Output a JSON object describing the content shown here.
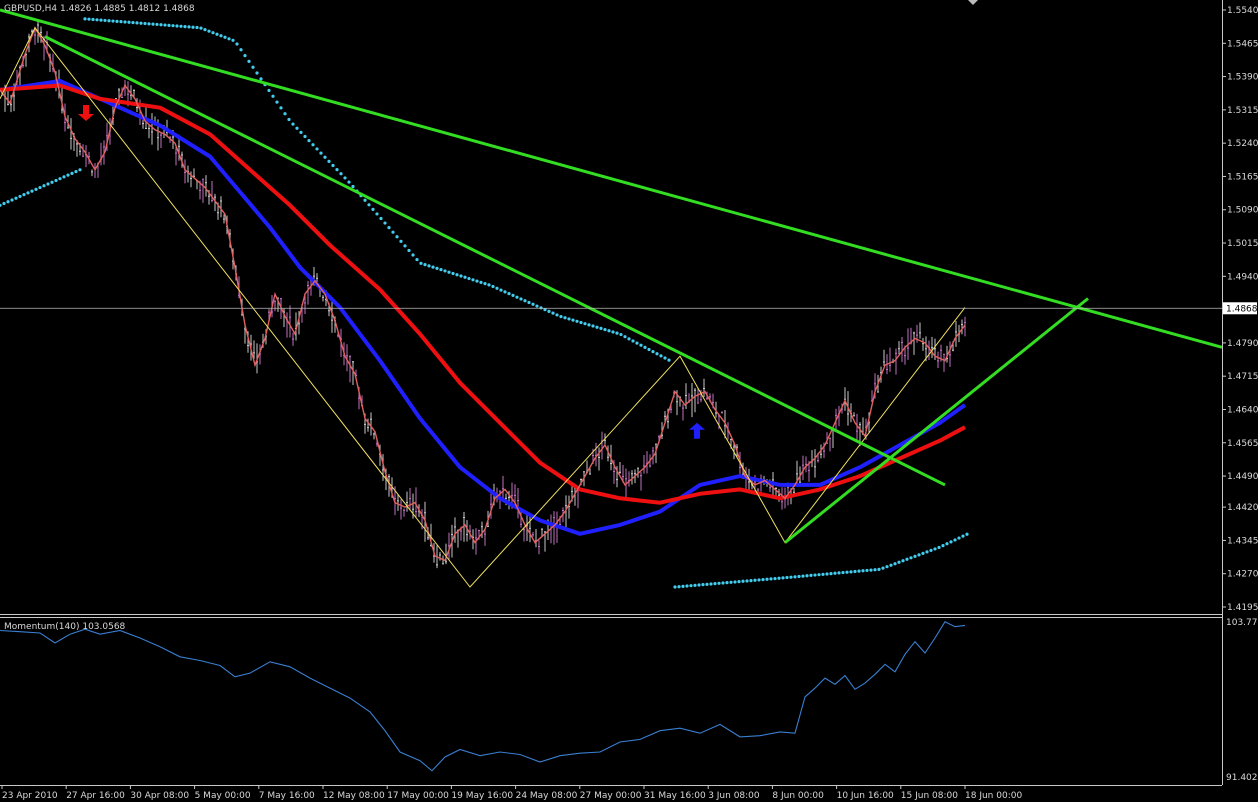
{
  "window": {
    "symbol_info": "GBPUSD,H4  1.4826 1.4885 1.4812 1.4868",
    "indicator_info": "Momentum(140) 103.0568"
  },
  "colors": {
    "background": "#000000",
    "candles": "#c8c8c8",
    "candle_accent": "#c070c0",
    "fast_ma": "#e06060",
    "ma_blue": "#2020ff",
    "ma_red": "#ee1010",
    "trendline": "#33dd22",
    "zigzag": "#f0e060",
    "sar": "#44ccee",
    "momentum": "#3a7fd0",
    "arrow_sell": "#ee1010",
    "arrow_buy": "#2020ff",
    "axis_text": "#d8d8d8"
  },
  "chart_data": [
    {
      "type": "candlestick",
      "symbol": "GBPUSD",
      "timeframe": "H4",
      "ohlc_header": {
        "open": 1.4826,
        "high": 1.4885,
        "low": 1.4812,
        "close": 1.4868
      },
      "current_price": "1.4868",
      "ylim": [
        1.4195,
        1.554
      ],
      "y_ticks": [
        "1.5540",
        "1.5465",
        "1.5390",
        "1.5315",
        "1.5240",
        "1.5165",
        "1.5090",
        "1.5015",
        "1.4940",
        "1.4790",
        "1.4715",
        "1.4640",
        "1.4565",
        "1.4490",
        "1.4420",
        "1.4345",
        "1.4270",
        "1.4195"
      ],
      "x_ticks": [
        "23 Apr 2010",
        "27 Apr 16:00",
        "30 Apr 08:00",
        "5 May 00:00",
        "7 May 16:00",
        "12 May 08:00",
        "17 May 00:00",
        "19 May 16:00",
        "24 May 08:00",
        "27 May 00:00",
        "31 May 16:00",
        "3 Jun 08:00",
        "8 Jun 00:00",
        "10 Jun 16:00",
        "15 Jun 08:00",
        "18 Jun 00:00"
      ],
      "close_path": [
        [
          0,
          1.536
        ],
        [
          10,
          1.533
        ],
        [
          25,
          1.544
        ],
        [
          35,
          1.55
        ],
        [
          45,
          1.546
        ],
        [
          55,
          1.54
        ],
        [
          65,
          1.53
        ],
        [
          75,
          1.525
        ],
        [
          85,
          1.522
        ],
        [
          95,
          1.518
        ],
        [
          105,
          1.522
        ],
        [
          115,
          1.532
        ],
        [
          125,
          1.537
        ],
        [
          135,
          1.534
        ],
        [
          145,
          1.529
        ],
        [
          155,
          1.527
        ],
        [
          165,
          1.526
        ],
        [
          175,
          1.524
        ],
        [
          185,
          1.518
        ],
        [
          195,
          1.516
        ],
        [
          205,
          1.514
        ],
        [
          215,
          1.511
        ],
        [
          225,
          1.508
        ],
        [
          235,
          1.496
        ],
        [
          245,
          1.483
        ],
        [
          255,
          1.474
        ],
        [
          265,
          1.48
        ],
        [
          275,
          1.49
        ],
        [
          285,
          1.485
        ],
        [
          295,
          1.481
        ],
        [
          305,
          1.49
        ],
        [
          315,
          1.493
        ],
        [
          325,
          1.49
        ],
        [
          335,
          1.484
        ],
        [
          345,
          1.476
        ],
        [
          355,
          1.472
        ],
        [
          365,
          1.462
        ],
        [
          375,
          1.459
        ],
        [
          385,
          1.45
        ],
        [
          395,
          1.443
        ],
        [
          405,
          1.442
        ],
        [
          415,
          1.443
        ],
        [
          425,
          1.439
        ],
        [
          435,
          1.431
        ],
        [
          445,
          1.43
        ],
        [
          455,
          1.436
        ],
        [
          465,
          1.438
        ],
        [
          475,
          1.434
        ],
        [
          485,
          1.437
        ],
        [
          495,
          1.444
        ],
        [
          505,
          1.446
        ],
        [
          515,
          1.443
        ],
        [
          525,
          1.438
        ],
        [
          535,
          1.434
        ],
        [
          545,
          1.436
        ],
        [
          555,
          1.438
        ],
        [
          565,
          1.441
        ],
        [
          575,
          1.445
        ],
        [
          585,
          1.449
        ],
        [
          595,
          1.453
        ],
        [
          605,
          1.456
        ],
        [
          615,
          1.451
        ],
        [
          625,
          1.447
        ],
        [
          635,
          1.449
        ],
        [
          645,
          1.451
        ],
        [
          655,
          1.454
        ],
        [
          665,
          1.461
        ],
        [
          675,
          1.468
        ],
        [
          685,
          1.465
        ],
        [
          695,
          1.467
        ],
        [
          705,
          1.468
        ],
        [
          715,
          1.464
        ],
        [
          725,
          1.461
        ],
        [
          735,
          1.456
        ],
        [
          745,
          1.449
        ],
        [
          755,
          1.447
        ],
        [
          765,
          1.448
        ],
        [
          775,
          1.446
        ],
        [
          785,
          1.444
        ],
        [
          795,
          1.447
        ],
        [
          805,
          1.451
        ],
        [
          815,
          1.453
        ],
        [
          825,
          1.456
        ],
        [
          835,
          1.461
        ],
        [
          845,
          1.466
        ],
        [
          855,
          1.461
        ],
        [
          865,
          1.458
        ],
        [
          875,
          1.468
        ],
        [
          885,
          1.474
        ],
        [
          895,
          1.475
        ],
        [
          905,
          1.478
        ],
        [
          915,
          1.48
        ],
        [
          925,
          1.479
        ],
        [
          935,
          1.476
        ],
        [
          945,
          1.475
        ],
        [
          955,
          1.48
        ],
        [
          965,
          1.483
        ]
      ],
      "series": [
        {
          "name": "",
          "color_key": "ma_blue",
          "points": [
            [
              0,
              1.536
            ],
            [
              60,
              1.538
            ],
            [
              100,
              1.534
            ],
            [
              160,
              1.528
            ],
            [
              210,
              1.521
            ],
            [
              240,
              1.513
            ],
            [
              270,
              1.505
            ],
            [
              300,
              1.496
            ],
            [
              340,
              1.487
            ],
            [
              380,
              1.475
            ],
            [
              420,
              1.462
            ],
            [
              460,
              1.451
            ],
            [
              500,
              1.444
            ],
            [
              540,
              1.439
            ],
            [
              580,
              1.436
            ],
            [
              620,
              1.438
            ],
            [
              660,
              1.441
            ],
            [
              700,
              1.447
            ],
            [
              740,
              1.449
            ],
            [
              780,
              1.447
            ],
            [
              820,
              1.447
            ],
            [
              860,
              1.451
            ],
            [
              900,
              1.456
            ],
            [
              940,
              1.461
            ],
            [
              965,
              1.465
            ]
          ]
        },
        {
          "name": "",
          "color_key": "ma_red",
          "points": [
            [
              0,
              1.536
            ],
            [
              60,
              1.537
            ],
            [
              100,
              1.534
            ],
            [
              160,
              1.532
            ],
            [
              210,
              1.526
            ],
            [
              250,
              1.518
            ],
            [
              290,
              1.51
            ],
            [
              330,
              1.501
            ],
            [
              380,
              1.491
            ],
            [
              420,
              1.481
            ],
            [
              460,
              1.47
            ],
            [
              500,
              1.461
            ],
            [
              540,
              1.452
            ],
            [
              580,
              1.446
            ],
            [
              620,
              1.444
            ],
            [
              660,
              1.443
            ],
            [
              700,
              1.445
            ],
            [
              740,
              1.446
            ],
            [
              780,
              1.444
            ],
            [
              820,
              1.446
            ],
            [
              860,
              1.449
            ],
            [
              900,
              1.453
            ],
            [
              940,
              1.457
            ],
            [
              965,
              1.46
            ]
          ]
        }
      ],
      "zigzag": [
        [
          0,
          1.534
        ],
        [
          35,
          1.55
        ],
        [
          470,
          1.424
        ],
        [
          680,
          1.476
        ],
        [
          785,
          1.434
        ],
        [
          965,
          1.487
        ]
      ],
      "parabolic_sar": [
        {
          "points": [
            [
              0,
              1.51
            ],
            [
              80,
              1.518
            ]
          ]
        },
        {
          "points": [
            [
              85,
              1.552
            ],
            [
              200,
              1.55
            ],
            [
              235,
              1.547
            ],
            [
              290,
              1.529
            ],
            [
              350,
              1.515
            ],
            [
              420,
              1.497
            ],
            [
              490,
              1.492
            ],
            [
              560,
              1.485
            ],
            [
              620,
              1.481
            ],
            [
              670,
              1.475
            ]
          ]
        },
        {
          "points": [
            [
              675,
              1.424
            ],
            [
              780,
              1.426
            ],
            [
              880,
              1.428
            ],
            [
              940,
              1.433
            ],
            [
              968,
              1.436
            ]
          ]
        }
      ],
      "trendlines": [
        {
          "from": [
            0,
            1.554
          ],
          "to": [
            1222,
            1.478
          ]
        },
        {
          "from": [
            45,
            1.548
          ],
          "to": [
            945,
            1.447
          ]
        },
        {
          "from": [
            785,
            1.434
          ],
          "to": [
            1088,
            1.489
          ]
        }
      ],
      "arrows": [
        {
          "direction": "sell",
          "x": 86,
          "price": 1.529
        },
        {
          "direction": "buy",
          "x": 697,
          "price": 1.461
        }
      ]
    },
    {
      "type": "line",
      "indicator": "Momentum",
      "period": 140,
      "value": "103.0568",
      "ylim": [
        91.4024,
        103.775
      ],
      "y_ticks": [
        "103.775",
        "91.4024"
      ],
      "values": [
        [
          0,
          103.1
        ],
        [
          20,
          103.0
        ],
        [
          40,
          102.9
        ],
        [
          55,
          102.1
        ],
        [
          70,
          102.8
        ],
        [
          85,
          103.2
        ],
        [
          100,
          102.8
        ],
        [
          120,
          103.1
        ],
        [
          140,
          102.5
        ],
        [
          160,
          101.8
        ],
        [
          180,
          101.0
        ],
        [
          200,
          100.7
        ],
        [
          220,
          100.3
        ],
        [
          235,
          99.4
        ],
        [
          250,
          99.7
        ],
        [
          270,
          100.6
        ],
        [
          290,
          100.2
        ],
        [
          310,
          99.3
        ],
        [
          330,
          98.5
        ],
        [
          350,
          97.7
        ],
        [
          370,
          96.6
        ],
        [
          385,
          95.1
        ],
        [
          400,
          93.4
        ],
        [
          420,
          92.7
        ],
        [
          432,
          91.9
        ],
        [
          445,
          93.0
        ],
        [
          460,
          93.6
        ],
        [
          480,
          93.1
        ],
        [
          500,
          93.4
        ],
        [
          520,
          93.2
        ],
        [
          540,
          92.6
        ],
        [
          560,
          93.1
        ],
        [
          580,
          93.3
        ],
        [
          600,
          93.4
        ],
        [
          620,
          94.2
        ],
        [
          640,
          94.4
        ],
        [
          660,
          95.1
        ],
        [
          680,
          95.3
        ],
        [
          700,
          94.9
        ],
        [
          720,
          95.6
        ],
        [
          740,
          94.6
        ],
        [
          760,
          94.7
        ],
        [
          780,
          95.0
        ],
        [
          795,
          94.9
        ],
        [
          805,
          97.8
        ],
        [
          815,
          98.5
        ],
        [
          825,
          99.3
        ],
        [
          835,
          98.8
        ],
        [
          845,
          99.5
        ],
        [
          855,
          98.4
        ],
        [
          865,
          98.9
        ],
        [
          875,
          99.6
        ],
        [
          885,
          100.4
        ],
        [
          895,
          99.8
        ],
        [
          905,
          101.2
        ],
        [
          915,
          102.2
        ],
        [
          925,
          101.3
        ],
        [
          935,
          102.5
        ],
        [
          945,
          103.8
        ],
        [
          955,
          103.4
        ],
        [
          965,
          103.5
        ]
      ]
    }
  ]
}
